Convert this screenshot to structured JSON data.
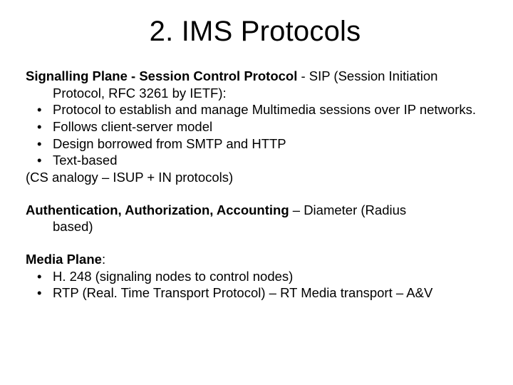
{
  "title": "2. IMS Protocols",
  "section1": {
    "lead_bold": "Signalling Plane - Session Control Protocol",
    "lead_rest": " - SIP (Session Initiation",
    "lead_cont": "Protocol, RFC 3261 by IETF):",
    "bullets": [
      "Protocol to establish and manage Multimedia sessions over IP networks.",
      "Follows client-server model",
      "Design borrowed from SMTP and HTTP",
      "Text-based"
    ],
    "tail": "(CS analogy – ISUP + IN protocols)"
  },
  "section2": {
    "lead_bold": "Authentication, Authorization, Accounting",
    "lead_rest": " – Diameter (Radius",
    "lead_cont": "based)"
  },
  "section3": {
    "lead_bold": "Media Plane",
    "lead_rest": ":",
    "bullets": [
      "H. 248 (signaling nodes to control nodes)",
      "RTP (Real. Time Transport Protocol) – RT Media transport – A&V"
    ]
  }
}
